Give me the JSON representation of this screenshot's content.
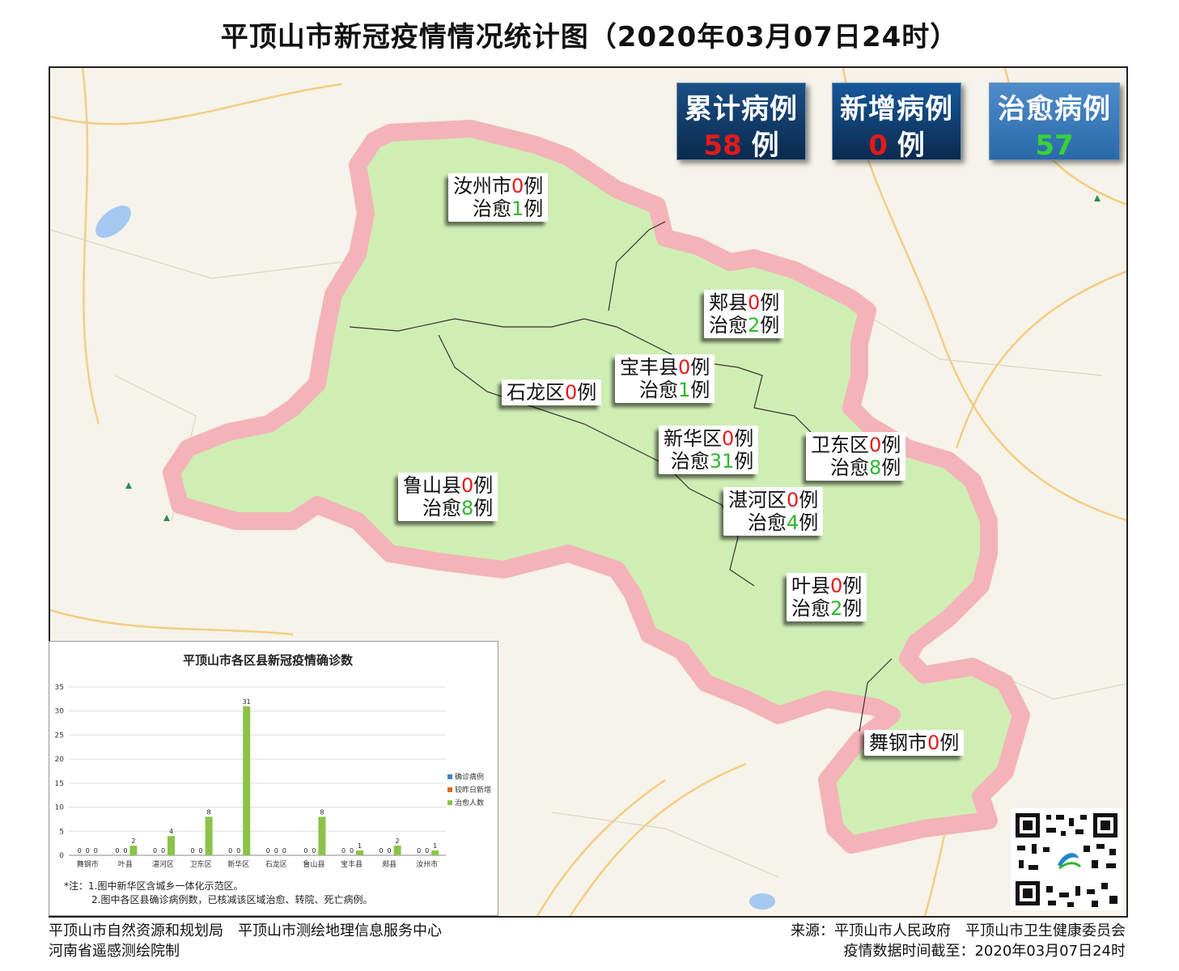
{
  "title": "平顶山市新冠疫情情况统计图（2020年03月07日24时）",
  "stats": [
    {
      "label": "累计病例",
      "value": "58",
      "unit": "例",
      "bg": "#1a4f86",
      "value_color": "#e21b1b"
    },
    {
      "label": "新增病例",
      "value": "0",
      "unit": "例",
      "bg": "#17589a",
      "value_color": "#e21b1b"
    },
    {
      "label": "治愈病例",
      "value": "57",
      "unit": "",
      "bg": "#4f8ccb",
      "value_color": "#39d139"
    }
  ],
  "region_labels": [
    {
      "name": "汝州市",
      "confirmed": "0",
      "unit": "例",
      "cured_label": "治愈",
      "cured": "1",
      "cured_unit": "例"
    },
    {
      "name": "郏县",
      "confirmed": "0",
      "unit": "例",
      "cured_label": "治愈",
      "cured": "2",
      "cured_unit": "例"
    },
    {
      "name": "宝丰县",
      "confirmed": "0",
      "unit": "例",
      "cured_label": "治愈",
      "cured": "1",
      "cured_unit": "例"
    },
    {
      "name": "石龙区",
      "confirmed": "0",
      "unit": "例"
    },
    {
      "name": "新华区",
      "confirmed": "0",
      "unit": "例",
      "cured_label": "治愈",
      "cured": "31",
      "cured_unit": "例"
    },
    {
      "name": "卫东区",
      "confirmed": "0",
      "unit": "例",
      "cured_label": "治愈",
      "cured": "8",
      "cured_unit": "例"
    },
    {
      "name": "鲁山县",
      "confirmed": "0",
      "unit": "例",
      "cured_label": "治愈",
      "cured": "8",
      "cured_unit": "例"
    },
    {
      "name": "湛河区",
      "confirmed": "0",
      "unit": "例",
      "cured_label": "治愈",
      "cured": "4",
      "cured_unit": "例"
    },
    {
      "name": "叶县",
      "confirmed": "0",
      "unit": "例",
      "cured_label": "治愈",
      "cured": "2",
      "cured_unit": "例"
    },
    {
      "name": "舞钢市",
      "confirmed": "0",
      "unit": "例"
    }
  ],
  "chart_data": {
    "type": "bar",
    "title": "平顶山市各区县新冠疫情确诊数",
    "categories": [
      "舞钢市",
      "叶县",
      "湛河区",
      "卫东区",
      "新华区",
      "石龙区",
      "鲁山县",
      "宝丰县",
      "郏县",
      "汝州市"
    ],
    "series": [
      {
        "name": "确诊病例",
        "color": "#3d85c6",
        "values": [
          0,
          0,
          0,
          0,
          0,
          0,
          0,
          0,
          0,
          0
        ]
      },
      {
        "name": "较昨日新增",
        "color": "#e06c1f",
        "values": [
          0,
          0,
          0,
          0,
          0,
          0,
          0,
          0,
          0,
          0
        ]
      },
      {
        "name": "治愈人数",
        "color": "#8bc34a",
        "values": [
          0,
          2,
          4,
          8,
          31,
          0,
          8,
          1,
          2,
          1
        ]
      }
    ],
    "ylim": [
      0,
      35
    ],
    "yticks": [
      0,
      5,
      10,
      15,
      20,
      25,
      30,
      35
    ],
    "grid": true,
    "legend": "right"
  },
  "chart_notes": [
    "*注：1.图中新华区含城乡一体化示范区。",
    "2.图中各区县确诊病例数，已核减该区域治愈、转院、死亡病例。"
  ],
  "footer": {
    "left_line1": "平顶山市自然资源和规划局　平顶山市测绘地理信息服务中心",
    "left_line2": "河南省遥感测绘院制",
    "right_line1": "来源：平顶山市人民政府　平顶山市卫生健康委员会",
    "right_line2": "疫情数据时间截至：2020年03月07日24时"
  }
}
